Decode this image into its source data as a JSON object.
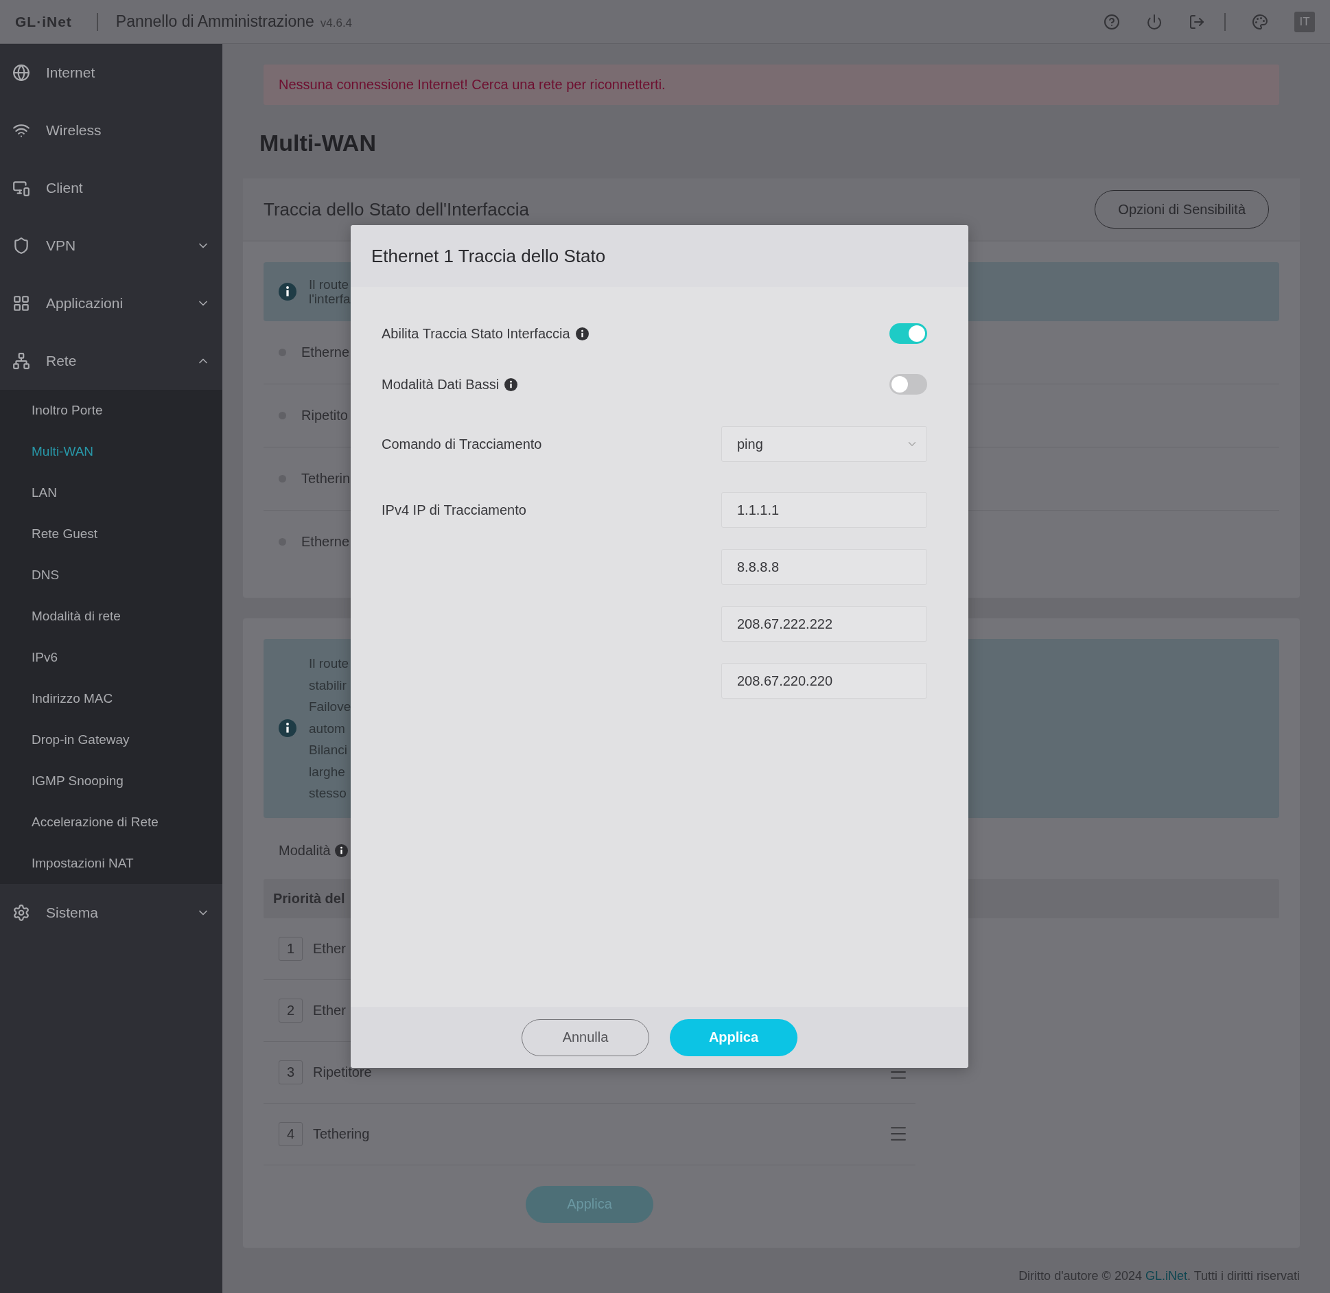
{
  "header": {
    "logo": "GL·iNet",
    "title": "Pannello di Amministrazione",
    "version": "v4.6.4",
    "language": "IT"
  },
  "sidebar": {
    "items": [
      {
        "kind": "link",
        "label": "Internet"
      },
      {
        "kind": "link",
        "label": "Wireless"
      },
      {
        "kind": "link",
        "label": "Client"
      },
      {
        "kind": "group",
        "label": "VPN",
        "expanded": false
      },
      {
        "kind": "group",
        "label": "Applicazioni",
        "expanded": false
      },
      {
        "kind": "group",
        "label": "Rete",
        "expanded": true,
        "children": [
          {
            "label": "Inoltro Porte",
            "selected": false
          },
          {
            "label": "Multi-WAN",
            "selected": true
          },
          {
            "label": "LAN",
            "selected": false
          },
          {
            "label": "Rete Guest",
            "selected": false
          },
          {
            "label": "DNS",
            "selected": false
          },
          {
            "label": "Modalità di rete",
            "selected": false
          },
          {
            "label": "IPv6",
            "selected": false
          },
          {
            "label": "Indirizzo MAC",
            "selected": false
          },
          {
            "label": "Drop-in Gateway",
            "selected": false
          },
          {
            "label": "IGMP Snooping",
            "selected": false
          },
          {
            "label": "Accelerazione di Rete",
            "selected": false
          },
          {
            "label": "Impostazioni NAT",
            "selected": false
          }
        ]
      },
      {
        "kind": "group",
        "label": "Sistema",
        "expanded": false
      }
    ]
  },
  "alert": "Nessuna connessione Internet! Cerca una rete per riconnetterti.",
  "page_title": "Multi-WAN",
  "tracking_card": {
    "title": "Traccia dello Stato dell'Interfaccia",
    "button": "Opzioni di Sensibilità",
    "info": [
      "Il route",
      "l'interfa"
    ],
    "interfaces": [
      "Etherne",
      "Ripetito",
      "Tetherin",
      "Etherne"
    ]
  },
  "mode_card": {
    "info": [
      "Il route",
      "stabilir",
      "Failove",
      "autom",
      "Bilanci",
      "larghe",
      "stesso"
    ],
    "mode_label": "Modalità",
    "priority_header": "Priorità del",
    "priorities": [
      {
        "number": "1",
        "label": "Ether",
        "drag_handle": false
      },
      {
        "number": "2",
        "label": "Ether",
        "drag_handle": false
      },
      {
        "number": "3",
        "label": "Ripetitore",
        "drag_handle": true
      },
      {
        "number": "4",
        "label": "Tethering",
        "drag_handle": true
      }
    ],
    "apply": {
      "label": "Applica",
      "disabled": true
    }
  },
  "modal": {
    "title": "Ethernet 1 Traccia dello Stato",
    "fields": [
      {
        "kind": "toggle",
        "label": "Abilita Traccia Stato Interfaccia",
        "on": true
      },
      {
        "kind": "toggle",
        "label": "Modalità Dati Bassi",
        "on": false
      },
      {
        "kind": "select",
        "label": "Comando di Tracciamento",
        "value": "ping"
      },
      {
        "kind": "inputs",
        "label": "IPv4 IP di Tracciamento",
        "values": [
          "1.1.1.1",
          "8.8.8.8",
          "208.67.222.222",
          "208.67.220.220"
        ]
      }
    ],
    "cancel": "Annulla",
    "confirm": "Applica"
  },
  "footer": {
    "text": "Diritto d'autore © 2024 ",
    "link": "GL.iNet",
    "suffix": ". Tutti i diritti riservati"
  }
}
